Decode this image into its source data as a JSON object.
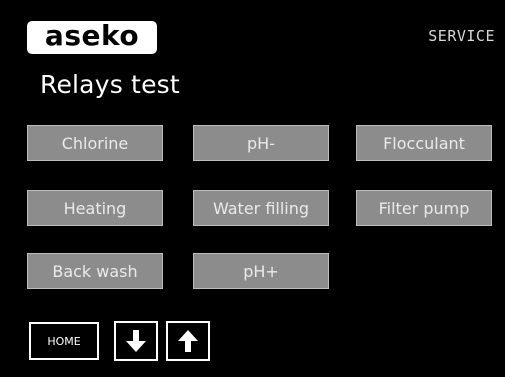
{
  "header": {
    "logo": "aseko",
    "mode": "SERVICE"
  },
  "title": "Relays test",
  "relays": [
    {
      "label": "Chlorine"
    },
    {
      "label": "pH-"
    },
    {
      "label": "Flocculant"
    },
    {
      "label": "Heating"
    },
    {
      "label": "Water filling"
    },
    {
      "label": "Filter pump"
    },
    {
      "label": "Back wash"
    },
    {
      "label": "pH+"
    }
  ],
  "footer": {
    "home_label": "HOME",
    "down_icon": "arrow-down-icon",
    "up_icon": "arrow-up-icon"
  },
  "colors": {
    "background": "#000000",
    "relay_button": "#8c8c8c",
    "text": "#ffffff"
  }
}
